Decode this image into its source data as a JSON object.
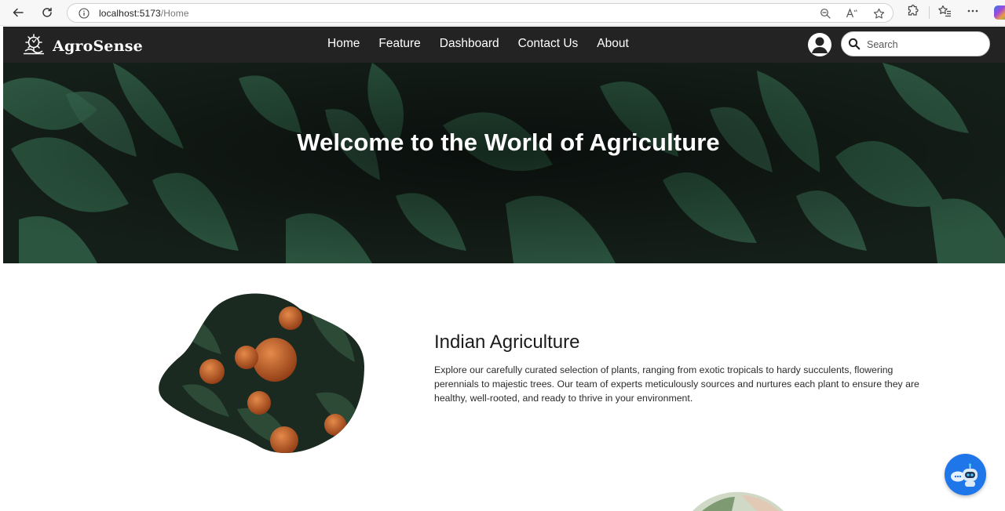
{
  "browser": {
    "url_host": "localhost:5173",
    "url_path": "/Home"
  },
  "site": {
    "brand": "AgroSense",
    "nav": [
      "Home",
      "Feature",
      "Dashboard",
      "Contact Us",
      "About"
    ],
    "search_placeholder": "Search"
  },
  "hero": {
    "title": "Welcome to the World of Agriculture"
  },
  "section": {
    "title": "Indian Agriculture",
    "body": "Explore our carefully curated selection of plants, ranging from exotic tropicals to hardy succulents, flowering perennials to majestic trees. Our team of experts meticulously sources and nurtures each plant to ensure they are healthy, well-rooted, and ready to thrive in your environment."
  },
  "colors": {
    "nav_bg": "#232323",
    "chatbot_bg": "#1f76e8",
    "hero_leaf": "#2d5a43"
  },
  "icons": [
    "back-arrow-icon",
    "reload-icon",
    "info-icon",
    "zoom-out-icon",
    "read-aloud-icon",
    "favorite-star-icon",
    "extensions-icon",
    "favorites-icon",
    "more-icon",
    "copilot-icon",
    "logo-icon",
    "user-icon",
    "search-icon",
    "chatbot-icon"
  ]
}
